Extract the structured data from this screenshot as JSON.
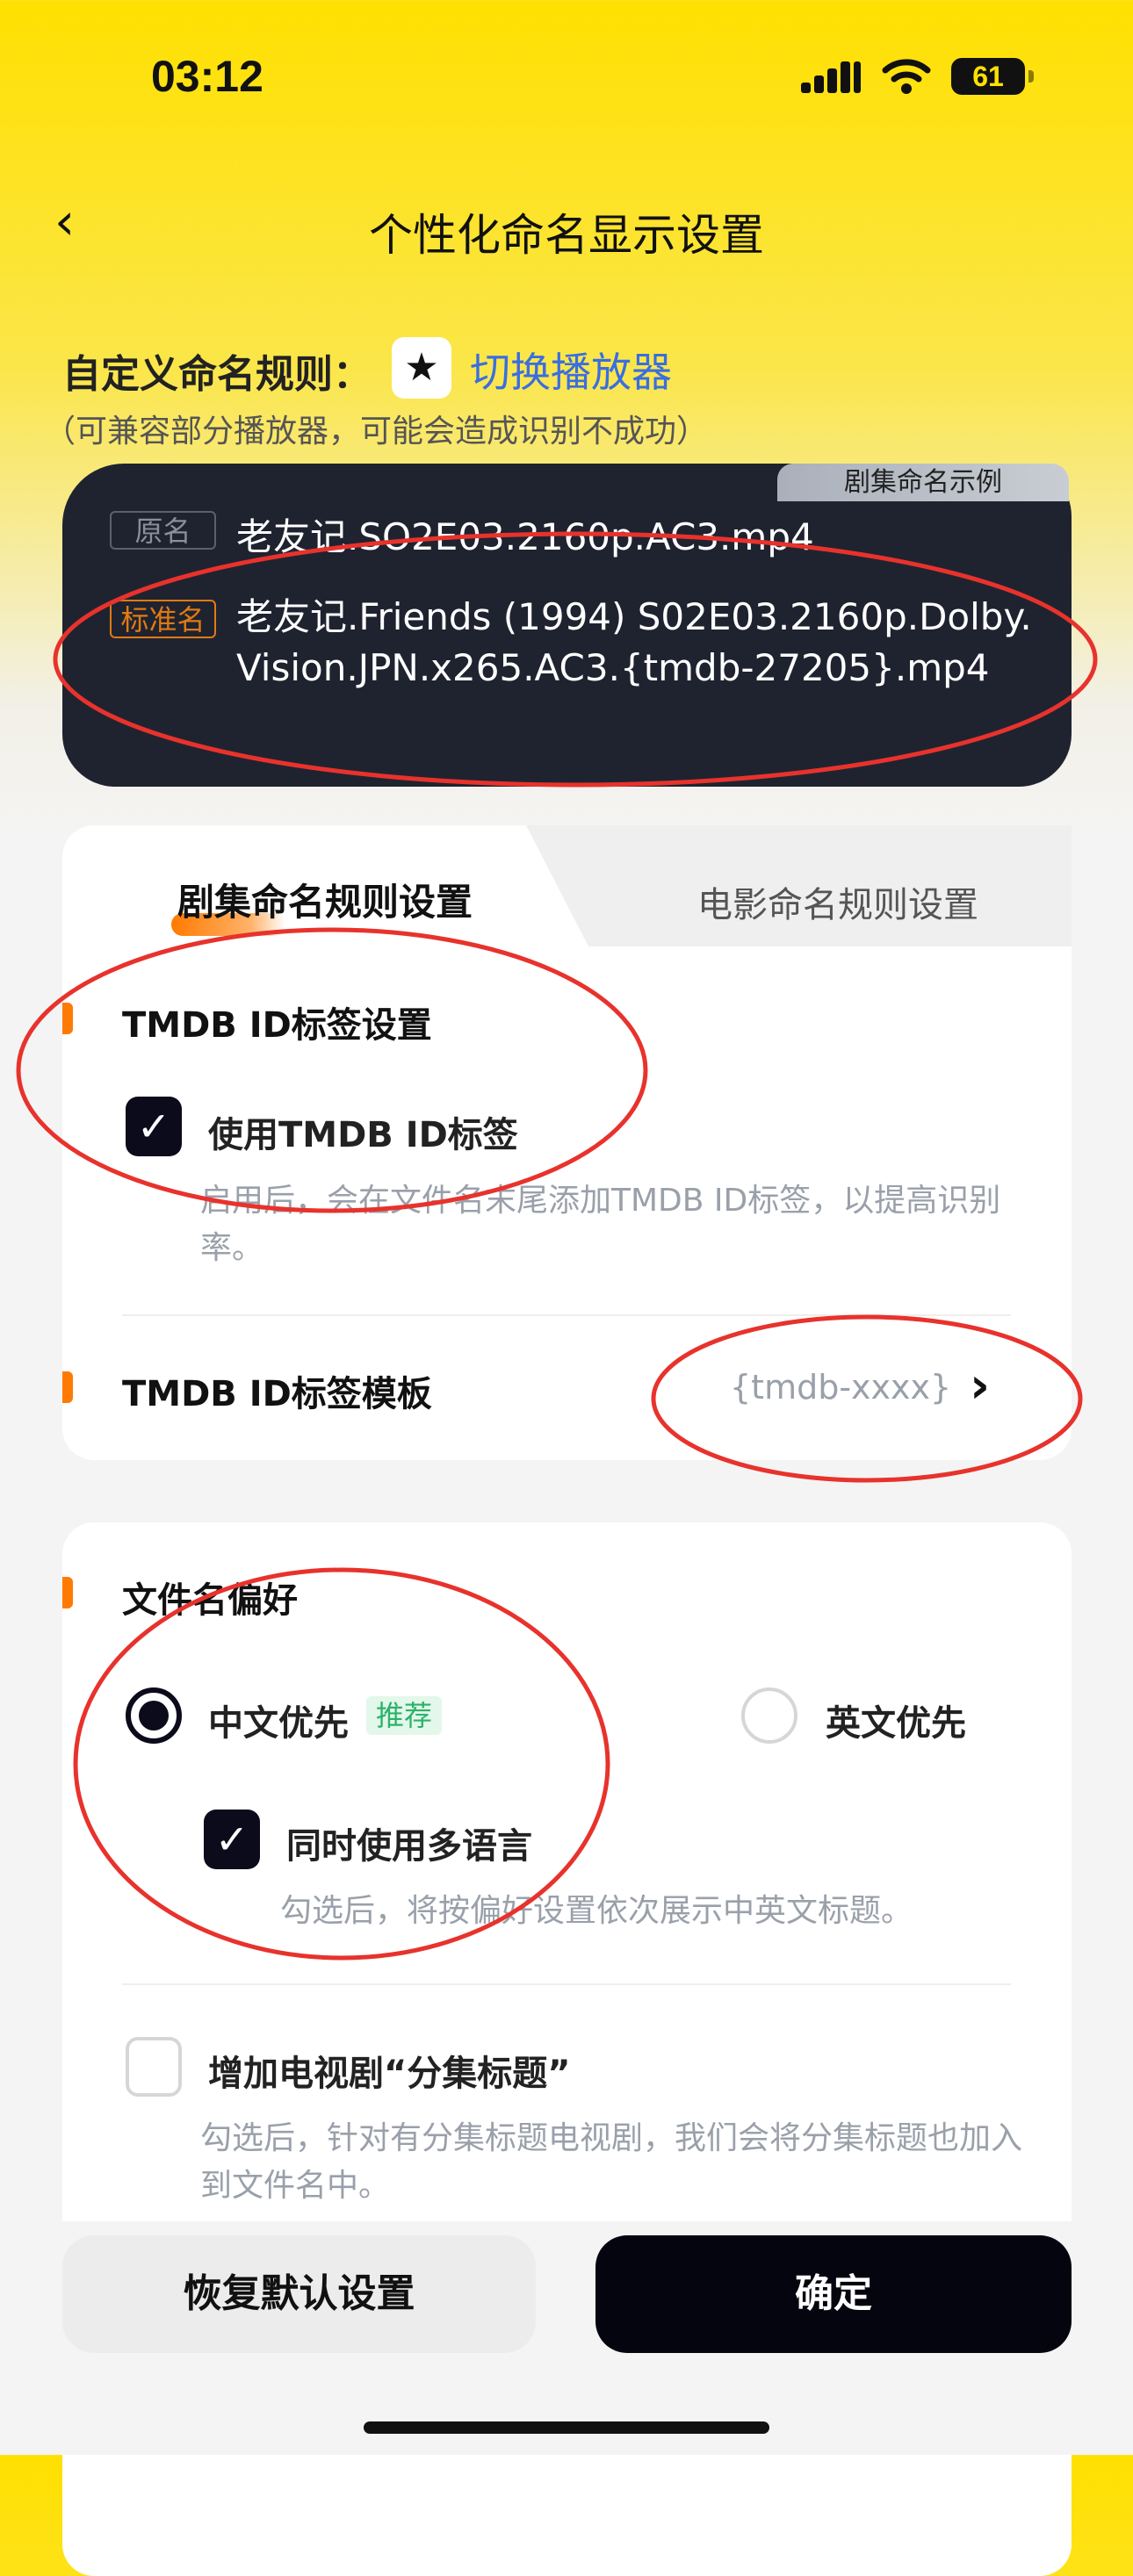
{
  "status_bar": {
    "time": "03:12",
    "battery": "61",
    "icons": [
      "signal-icon",
      "wifi-icon",
      "battery-icon"
    ]
  },
  "header": {
    "title": "个性化命名显示设置",
    "back_icon": "chevron-left-icon"
  },
  "rule": {
    "label": "自定义命名规则：",
    "player_icon": "star-icon",
    "switch_label": "切换播放器",
    "note": "（可兼容部分播放器，可能会造成识别不成功）"
  },
  "example": {
    "tab": "剧集命名示例",
    "original_badge": "原名",
    "original_name": "老友记.SO2E03.2160p.AC3.mp4",
    "standard_badge": "标准名",
    "standard_name": "老友记.Friends (1994) S02E03.2160p.Dolby.Vision.JPN.x265.AC3.{tmdb-27205}.mp4"
  },
  "tabs": [
    {
      "label": "剧集命名规则设置",
      "active": true
    },
    {
      "label": "电影命名规则设置",
      "active": false
    }
  ],
  "tmdb": {
    "section_title": "TMDB ID标签设置",
    "use_label": "使用TMDB ID标签",
    "use_checked": true,
    "use_desc": "启用后，会在文件名末尾添加TMDB ID标签，以提高识别率。",
    "template_label": "TMDB ID标签模板",
    "template_value": "{tmdb-xxxx}"
  },
  "filename": {
    "section_title": "文件名偏好",
    "options": [
      {
        "label": "中文优先",
        "badge": "推荐",
        "selected": true
      },
      {
        "label": "英文优先",
        "selected": false
      }
    ],
    "multi_label": "同时使用多语言",
    "multi_checked": true,
    "multi_desc": "勾选后，将按偏好设置依次展示中英文标题。",
    "episode_label": "增加电视剧“分集标题”",
    "episode_checked": false,
    "episode_desc": "勾选后，针对有分集标题电视剧，我们会将分集标题也加入到文件名中。"
  },
  "footer": {
    "reset": "恢复默认设置",
    "confirm": "确定"
  },
  "colors": {
    "accent": "#ff7a00",
    "link": "#3a6ee0",
    "annotation": "#e8322c",
    "dark_card": "#1f2330"
  }
}
